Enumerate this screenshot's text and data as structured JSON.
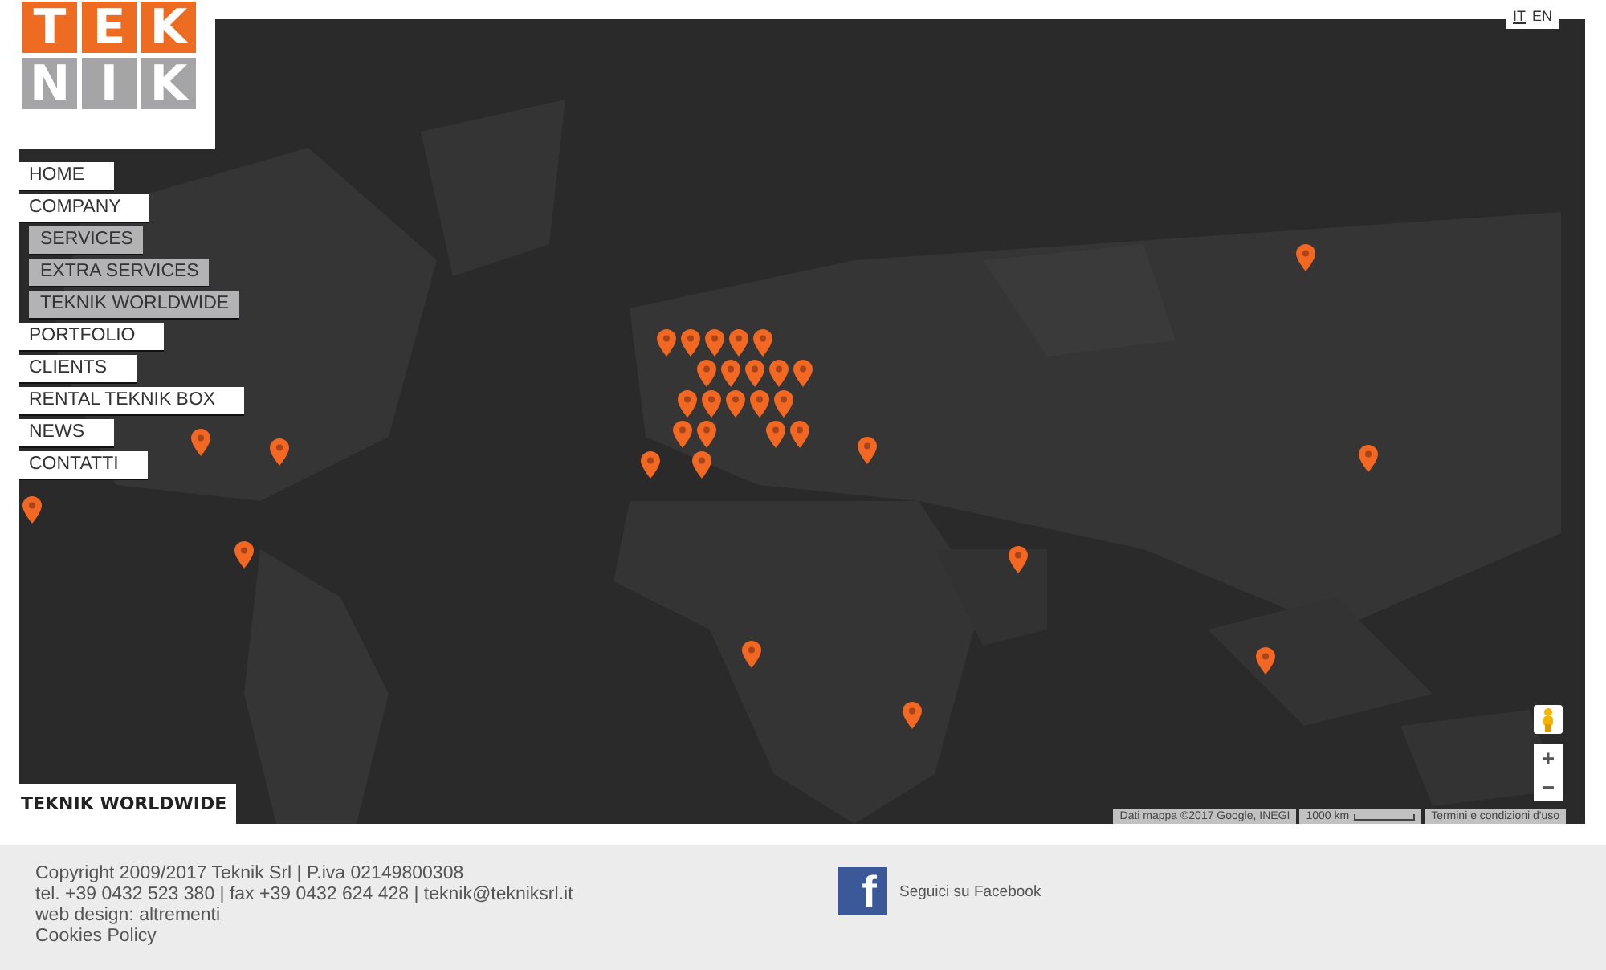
{
  "logo": {
    "rows": [
      [
        {
          "letter": "T",
          "kind": "accent"
        },
        {
          "letter": "E",
          "kind": "accent"
        },
        {
          "letter": "K",
          "kind": "accent"
        }
      ],
      [
        {
          "letter": "N",
          "kind": "muted"
        },
        {
          "letter": "I",
          "kind": "muted"
        },
        {
          "letter": "K",
          "kind": "muted"
        }
      ]
    ]
  },
  "languages": [
    {
      "label": "IT",
      "selected": true
    },
    {
      "label": "EN",
      "selected": false
    }
  ],
  "menu": [
    {
      "label": "HOME"
    },
    {
      "label": "COMPANY",
      "children": [
        {
          "label": "SERVICES"
        },
        {
          "label": "EXTRA SERVICES"
        },
        {
          "label": "TEKNIK WORLDWIDE"
        }
      ]
    },
    {
      "label": "PORTFOLIO"
    },
    {
      "label": "CLIENTS"
    },
    {
      "label": "RENTAL TEKNIK BOX"
    },
    {
      "label": "NEWS"
    },
    {
      "label": "CONTATTI"
    }
  ],
  "map": {
    "zoom_controls": [
      "+",
      "−"
    ],
    "attribution": [
      "Dati mappa ©2017 Google, INEGI",
      "1000 km",
      "Termini e condizioni d'uso"
    ]
  },
  "page_title": "TEKNIK WORLDWIDE",
  "footer": {
    "lines": [
      "Copyright 2009/2017 Teknik Srl | P.iva 02149800308",
      "tel. +39 0432 523 380 | fax +39 0432 624 428 | teknik@tekniksrl.it",
      "web design: altrementi",
      "Cookies Policy"
    ],
    "facebook": {
      "glyph": "f",
      "label": "Seguici su Facebook"
    }
  }
}
